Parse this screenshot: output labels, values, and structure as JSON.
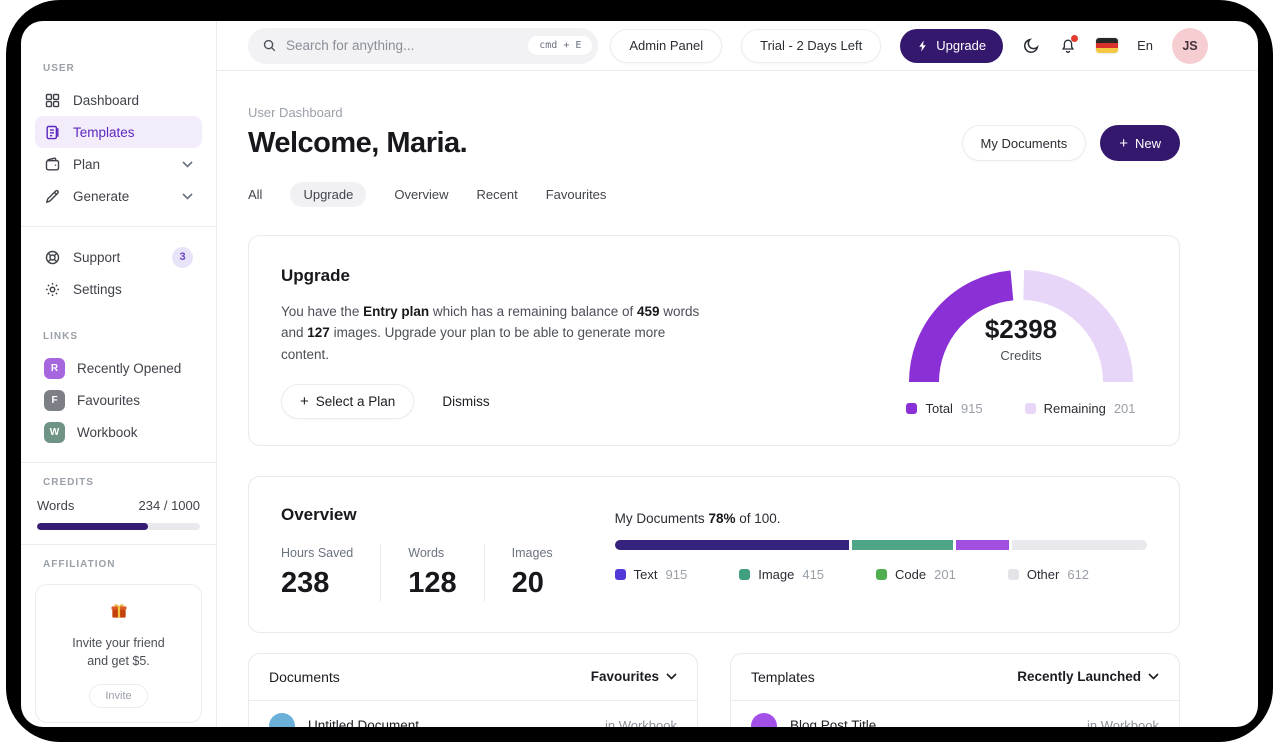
{
  "icons": {
    "plus": "+"
  },
  "sidebar": {
    "user_label": "USER",
    "items": [
      {
        "label": "Dashboard"
      },
      {
        "label": "Templates"
      },
      {
        "label": "Plan"
      },
      {
        "label": "Generate"
      }
    ],
    "secondary": [
      {
        "label": "Support",
        "badge": "3"
      },
      {
        "label": "Settings"
      }
    ],
    "links_label": "LINKS",
    "links": [
      {
        "initial": "R",
        "label": "Recently Opened",
        "color": "#a666dd"
      },
      {
        "initial": "F",
        "label": "Favourites",
        "color": "#7c8086"
      },
      {
        "initial": "W",
        "label": "Workbook",
        "color": "#6f9486"
      }
    ],
    "credits_label": "CREDITS",
    "credits": {
      "label": "Words",
      "value": "234 / 1000",
      "percent": 68,
      "fill_color": "#341d72"
    },
    "affiliation_label": "AFFILIATION",
    "affiliation": {
      "line1": "Invite your friend",
      "line2": "and get $5.",
      "button_label": "Invite"
    }
  },
  "topbar": {
    "search": {
      "placeholder": "Search for anything...",
      "shortcut": "cmd + E"
    },
    "admin_panel_label": "Admin Panel",
    "trial_label": "Trial - 2 Days Left",
    "upgrade_label": "Upgrade",
    "language": "En",
    "avatar_initials": "JS"
  },
  "header": {
    "breadcrumb": "User Dashboard",
    "title": "Welcome, Maria.",
    "my_documents_label": "My Documents",
    "new_label": "New",
    "tabs": [
      {
        "label": "All"
      },
      {
        "label": "Upgrade"
      },
      {
        "label": "Overview"
      },
      {
        "label": "Recent"
      },
      {
        "label": "Favourites"
      }
    ],
    "active_tab": "Upgrade"
  },
  "upgrade_card": {
    "title": "Upgrade",
    "paragraph": {
      "p1": "You have the ",
      "b1": "Entry plan",
      "p2": " which has a remaining balance of ",
      "b2": "459",
      "p3": " words and ",
      "b3": "127",
      "p4": " images. Upgrade your plan to be able to generate more content."
    },
    "select_plan_label": "Select a Plan",
    "dismiss_label": "Dismiss",
    "chart_data": {
      "type": "semicircle-donut",
      "center_value": "$2398",
      "center_label": "Credits",
      "series": [
        {
          "name": "Total",
          "value": 915,
          "color": "#8b2fd6"
        },
        {
          "name": "Remaining",
          "value": 201,
          "color": "#e8d6f8"
        }
      ],
      "display_sweep_pct": 47,
      "gap_deg": 7
    }
  },
  "overview_card": {
    "title": "Overview",
    "stats": [
      {
        "label": "Hours Saved",
        "value": "238"
      },
      {
        "label": "Words",
        "value": "128"
      },
      {
        "label": "Images",
        "value": "20"
      }
    ],
    "chart_data": {
      "type": "stacked-bar",
      "caption_prefix": "My Documents ",
      "caption_bold": "78%",
      "caption_suffix": " of 100.",
      "total": 100,
      "percent": 78,
      "segments": [
        {
          "name": "Text",
          "value": 915,
          "bar_color": "#35227d",
          "legend_color": "#5339d8",
          "width_pct": 44
        },
        {
          "name": "Image",
          "value": 415,
          "bar_color": "#4ea687",
          "legend_color": "#3f9f80",
          "width_pct": 19
        },
        {
          "name": "Code",
          "value": 201,
          "bar_color": "#a14fe0",
          "legend_color": "#4fae4f",
          "width_pct": 10
        },
        {
          "name": "Other",
          "value": 612,
          "bar_color": "#e9e9ed",
          "legend_color": "#e3e3e8",
          "width_pct": 27
        }
      ]
    }
  },
  "documents_card": {
    "title": "Documents",
    "filter_label": "Favourites",
    "rows": [
      {
        "name": "Untitled Document",
        "location": "in Workbook",
        "color": "#6ab0d8"
      }
    ]
  },
  "templates_card": {
    "title": "Templates",
    "filter_label": "Recently Launched",
    "rows": [
      {
        "name": "Blog Post Title",
        "location": "in Workbook",
        "color": "#a350e8"
      }
    ]
  }
}
